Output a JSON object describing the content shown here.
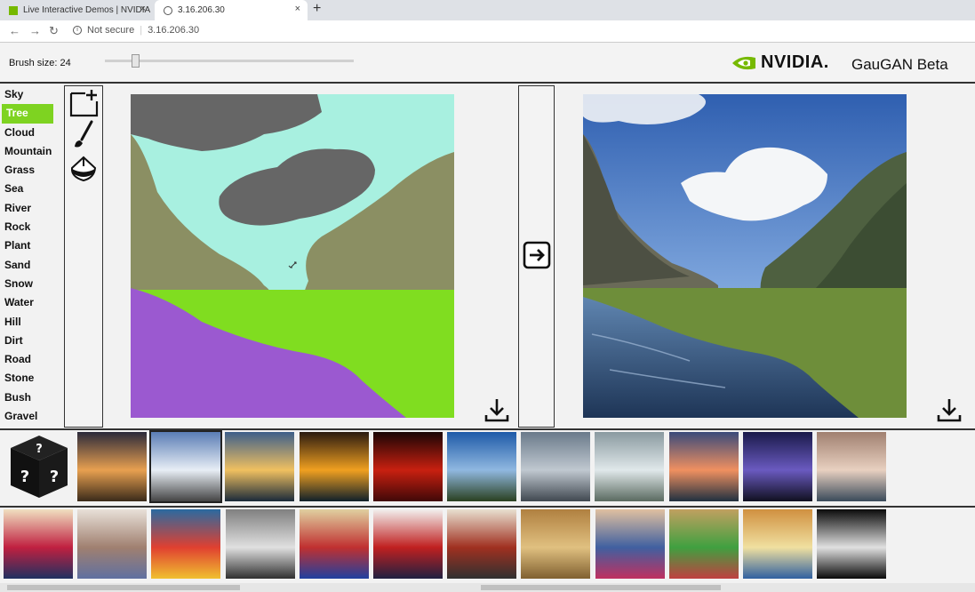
{
  "browser": {
    "tabs": [
      {
        "title": "Live Interactive Demos | NVIDIA",
        "close": "×"
      },
      {
        "title": "3.16.206.30",
        "close": "×"
      }
    ],
    "new_tab": "+",
    "security": "Not secure",
    "url": "3.16.206.30"
  },
  "header": {
    "brush_label": "Brush size: 24",
    "brush_size": 24,
    "brand": "NVIDIA.",
    "app_title": "GauGAN Beta"
  },
  "labels": [
    {
      "text": "Sky",
      "selected": false
    },
    {
      "text": "Tree",
      "selected": true
    },
    {
      "text": "Cloud",
      "selected": false
    },
    {
      "text": "Mountain",
      "selected": false
    },
    {
      "text": "Grass",
      "selected": false
    },
    {
      "text": "Sea",
      "selected": false
    },
    {
      "text": "River",
      "selected": false
    },
    {
      "text": "Rock",
      "selected": false
    },
    {
      "text": "Plant",
      "selected": false
    },
    {
      "text": "Sand",
      "selected": false
    },
    {
      "text": "Snow",
      "selected": false
    },
    {
      "text": "Water",
      "selected": false
    },
    {
      "text": "Hill",
      "selected": false
    },
    {
      "text": "Dirt",
      "selected": false
    },
    {
      "text": "Road",
      "selected": false
    },
    {
      "text": "Stone",
      "selected": false
    },
    {
      "text": "Bush",
      "selected": false
    },
    {
      "text": "Gravel",
      "selected": false
    }
  ],
  "tools": [
    "new-canvas-icon",
    "brush-icon",
    "fill-bucket-icon"
  ],
  "colors": {
    "accent": "#7ed321",
    "nvidia_green": "#76b900",
    "sky": "#a8f0e0",
    "cloud": "#666666",
    "mountain": "#8b8f63",
    "grass": "#80dd20",
    "water": "#9b59d0"
  },
  "style_row_1": [
    "sunset-dusk",
    "cloudy-road",
    "sunset-lake",
    "orange-sunset",
    "red-sky",
    "fjord-cliffs",
    "overcast-beach",
    "pale-shore",
    "pink-clouds",
    "purple-dusk",
    "calm-sea"
  ],
  "style_row_2": [
    "circles-art",
    "floral-sketch",
    "umbrella-painting",
    "cubist-gray",
    "kandinsky",
    "handprint",
    "abstract-lines",
    "golden-texture",
    "matisse-portrait",
    "picasso-portrait",
    "self-portrait",
    "black-white-lines"
  ]
}
